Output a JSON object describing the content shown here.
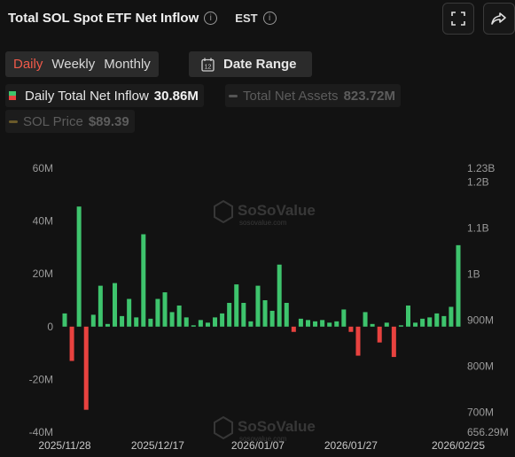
{
  "header": {
    "title": "Total SOL Spot ETF Net Inflow",
    "timezone": "EST",
    "info_icon": "info-icon"
  },
  "toolbar": {
    "fullscreen_icon": "fullscreen-icon",
    "share_icon": "share-icon"
  },
  "tabs": [
    {
      "label": "Daily",
      "active": true
    },
    {
      "label": "Weekly",
      "active": false
    },
    {
      "label": "Monthly",
      "active": false
    }
  ],
  "date_range": {
    "label": "Date Range",
    "icon": "calendar-icon",
    "icon_text": "12"
  },
  "legend": [
    {
      "label": "Daily Total Net Inflow",
      "value": "30.86M",
      "active": true,
      "color_pos": "#3ec46d",
      "color_neg": "#e8423f"
    },
    {
      "label": "Total Net Assets",
      "value": "823.72M",
      "active": false,
      "color": "#555555"
    },
    {
      "label": "SOL Price",
      "value": "$89.39",
      "active": false,
      "color": "#6a5a2a"
    }
  ],
  "watermark": {
    "text": "SoSoValue",
    "subtext": "sosovalue.com"
  },
  "colors": {
    "positive": "#3ec46d",
    "negative": "#e8423f",
    "axis_text": "#9a9a9a",
    "background": "#121212"
  },
  "chart_data": {
    "type": "bar",
    "series": [
      {
        "name": "Daily Total Net Inflow",
        "unit": "M USD",
        "values": [
          5.0,
          -13.0,
          45.5,
          -31.5,
          4.5,
          15.5,
          1.0,
          16.5,
          4.0,
          10.5,
          3.5,
          35.0,
          3.0,
          10.5,
          13.0,
          5.5,
          8.0,
          3.5,
          0.5,
          2.5,
          1.5,
          3.5,
          5.0,
          9.0,
          16.0,
          9.0,
          2.0,
          15.5,
          10.0,
          6.0,
          23.5,
          9.0,
          -2.0,
          3.0,
          2.5,
          2.0,
          2.5,
          1.5,
          2.0,
          6.5,
          -2.0,
          -11.0,
          5.5,
          1.0,
          -6.0,
          1.5,
          -11.5,
          0.5,
          8.0,
          1.5,
          3.0,
          3.5,
          5.0,
          4.0,
          7.5,
          30.86
        ]
      }
    ],
    "x_ticks": [
      "2025/11/28",
      "2025/12/17",
      "2026/01/07",
      "2026/01/27",
      "2026/02/25"
    ],
    "x_tick_positions": [
      0,
      13,
      27,
      40,
      55
    ],
    "y_left_ticks": [
      "60M",
      "40M",
      "20M",
      "0",
      "-20M",
      "-40M"
    ],
    "y_left_values": [
      60,
      40,
      20,
      0,
      -20,
      -40
    ],
    "ylim": [
      -40,
      60
    ],
    "y_right_ticks": [
      "1.23B",
      "1.2B",
      "1.1B",
      "1B",
      "900M",
      "800M",
      "700M",
      "656.29M"
    ],
    "y_right_values": [
      1230,
      1200,
      1100,
      1000,
      900,
      800,
      700,
      656.29
    ],
    "y_right_lim": [
      656.29,
      1230
    ],
    "grid": false,
    "title": "",
    "xlabel": "",
    "ylabel": ""
  }
}
